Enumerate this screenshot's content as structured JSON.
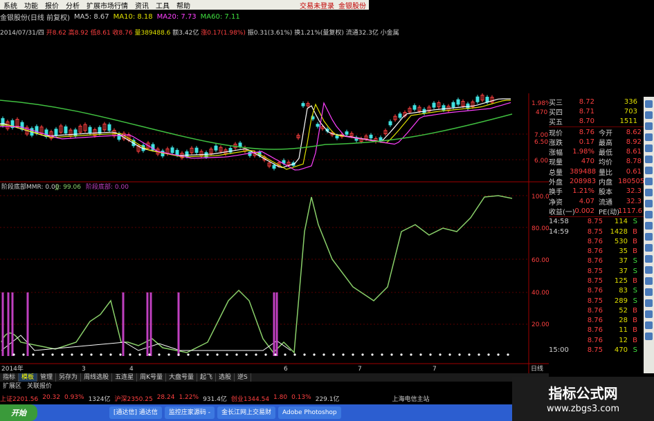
{
  "menu": {
    "items": [
      "系统",
      "功能",
      "报价",
      "分析",
      "扩展市场行情",
      "资讯",
      "工具",
      "帮助"
    ],
    "right": [
      "交易未登录",
      "金银股份"
    ]
  },
  "title": {
    "stock": "金银股份(日线 前复权)",
    "ma5": "MA5: 8.67",
    "ma10": "MA10: 8.18",
    "ma20": "MA20: 7.73",
    "ma60": "MA60: 7.11"
  },
  "info": {
    "date": "2014/07/31/四",
    "open": "开8.62",
    "high": "高8.92",
    "low": "低8.61",
    "close": "收8.76",
    "volume": "量389488.6",
    "amount": "额3.42亿",
    "change": "涨0.17(1.98%)",
    "amplitude": "振0.31(3.61%)",
    "turnover": "换1.21%(量复权)",
    "float": "流通32.3亿 小金属"
  },
  "colors": {
    "up": "#ff4040",
    "down": "#40e0e0",
    "ma5": "#ffffff",
    "ma10": "#e0e000",
    "ma20": "#ff40ff",
    "ma60": "#40c040",
    "indicator": "#8ad06a",
    "bar": "#c040c0"
  },
  "price_axis": [
    "7.00",
    "6.50",
    "6.00"
  ],
  "price_axis_top": [
    "1.98%",
    "470"
  ],
  "indicator": {
    "header": "阶段底部",
    "mmr": "MMR: 0.00",
    "jj": "JJ: 99.06",
    "extra": "阶段底部: 0.00"
  },
  "indicator_axis": [
    "100.0",
    "80.00",
    "60.00",
    "40.00",
    "20.00"
  ],
  "date_axis": [
    "2014年",
    "3",
    "4",
    "5",
    "6",
    "7"
  ],
  "date_axis_right": "日线",
  "quote": {
    "asks": [
      {
        "label": "买三",
        "price": "8.72",
        "vol": "336"
      },
      {
        "label": "买四",
        "price": "8.71",
        "vol": "703"
      },
      {
        "label": "买五",
        "price": "8.70",
        "vol": "1511"
      }
    ],
    "stats": [
      {
        "l1": "现价",
        "v1": "8.76",
        "l2": "今开",
        "v2": "8.62"
      },
      {
        "l1": "涨跌",
        "v1": "0.17",
        "l2": "最高",
        "v2": "8.92"
      },
      {
        "l1": "涨幅",
        "v1": "1.98%",
        "l2": "最低",
        "v2": "8.61"
      },
      {
        "l1": "现量",
        "v1": "470",
        "l2": "均价",
        "v2": "8.78"
      },
      {
        "l1": "总量",
        "v1": "389488",
        "l2": "量比",
        "v2": "0.61"
      },
      {
        "l1": "外盘",
        "v1": "208983",
        "l2": "内盘",
        "v2": "180505"
      },
      {
        "l1": "换手",
        "v1": "1.21%",
        "l2": "股本",
        "v2": "32.3"
      },
      {
        "l1": "净资",
        "v1": "4.07",
        "l2": "流通",
        "v2": "32.3"
      },
      {
        "l1": "收益(一)",
        "v1": "0.002",
        "l2": "PE(动)",
        "v2": "1117.6"
      }
    ],
    "ticks": [
      {
        "t": "14:58",
        "p": "8.75",
        "v": "114",
        "bs": "S"
      },
      {
        "t": "14:59",
        "p": "8.75",
        "v": "1428",
        "bs": "B"
      },
      {
        "t": "",
        "p": "8.76",
        "v": "530",
        "bs": "B"
      },
      {
        "t": "",
        "p": "8.76",
        "v": "35",
        "bs": "B"
      },
      {
        "t": "",
        "p": "8.76",
        "v": "37",
        "bs": "S"
      },
      {
        "t": "",
        "p": "8.75",
        "v": "37",
        "bs": "S"
      },
      {
        "t": "",
        "p": "8.75",
        "v": "125",
        "bs": "B"
      },
      {
        "t": "",
        "p": "8.76",
        "v": "83",
        "bs": "S"
      },
      {
        "t": "",
        "p": "8.75",
        "v": "289",
        "bs": "S"
      },
      {
        "t": "",
        "p": "8.76",
        "v": "52",
        "bs": "B"
      },
      {
        "t": "",
        "p": "8.76",
        "v": "28",
        "bs": "B"
      },
      {
        "t": "",
        "p": "8.76",
        "v": "11",
        "bs": "B"
      },
      {
        "t": "",
        "p": "8.76",
        "v": "12",
        "bs": "B"
      },
      {
        "t": "15:00",
        "p": "8.75",
        "v": "470",
        "bs": "S"
      },
      {
        "t": "",
        "p": "8.76",
        "v": "0",
        "bs": "B"
      }
    ]
  },
  "tabs": [
    "指标",
    "模板",
    "管理",
    "另存为",
    "周线选股",
    "五连星",
    "周K号量",
    "大盘号量",
    "起飞",
    "选股",
    "逆S"
  ],
  "tabs2": [
    "扩展区",
    "关联报价"
  ],
  "ticker": {
    "sh": "上证2201.56",
    "sh_chg": "20.32",
    "sh_pct": "0.93%",
    "sh_amt": "1324亿",
    "hs": "沪深2350.25",
    "hs_chg": "28.24",
    "hs_pct": "1.22%",
    "hs_amt": "931.4亿",
    "cy": "创业1344.54",
    "cy_chg": "1.80",
    "cy_pct": "0.13%",
    "cy_amt": "229.1亿",
    "station": "上海电信主站"
  },
  "taskbar": {
    "start": "开始",
    "tasks": [
      "[通达信] 通达信",
      "监控庄家源码 -",
      "金长江网上交易财",
      "Adobe Photoshop"
    ]
  },
  "watermark": {
    "title": "指标公式网",
    "url": "www.zbgs3.com"
  }
}
